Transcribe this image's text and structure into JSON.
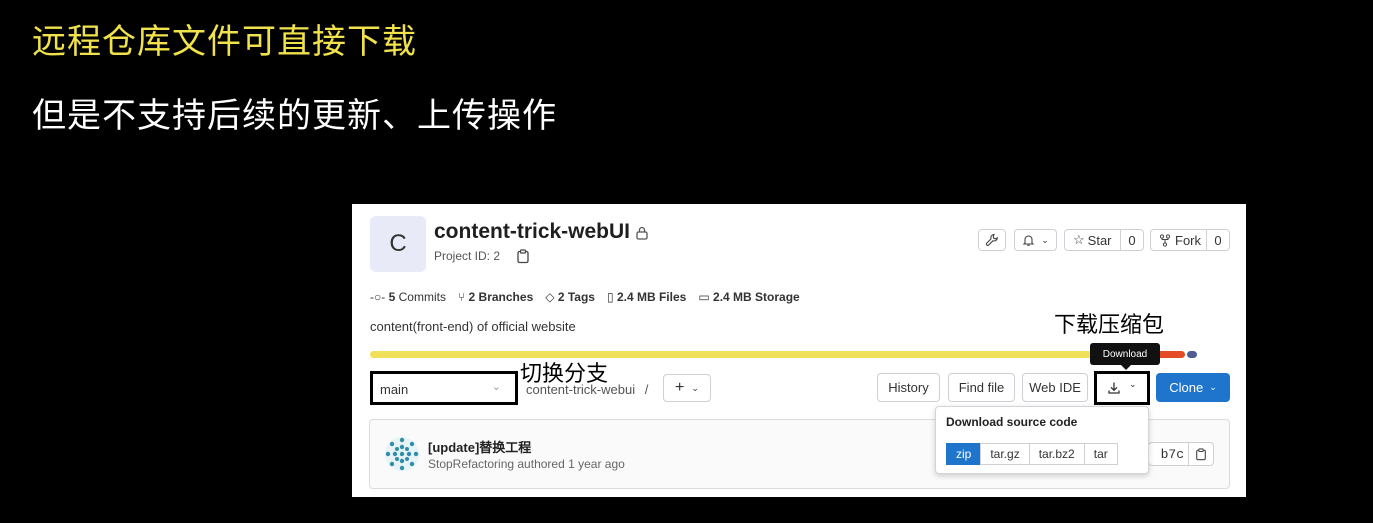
{
  "slide": {
    "title": "远程仓库文件可直接下载",
    "subtitle": "但是不支持后续的更新、上传操作"
  },
  "annotations": {
    "download_package": "下载压缩包",
    "switch_branch": "切换分支"
  },
  "project": {
    "avatar_letter": "C",
    "name": "content-trick-webUI",
    "project_id": "Project ID: 2",
    "description": "content(front-end) of official website"
  },
  "header_actions": {
    "star_label": "Star",
    "star_count": "0",
    "fork_label": "Fork",
    "fork_count": "0"
  },
  "stats": [
    {
      "icon": "commit-icon",
      "value": "5",
      "label": "Commits"
    },
    {
      "icon": "branch-icon",
      "value": "2",
      "label": "Branches"
    },
    {
      "icon": "tag-icon",
      "value": "2",
      "label": "Tags"
    },
    {
      "icon": "file-icon",
      "value": "2.4 MB",
      "label": "Files"
    },
    {
      "icon": "storage-icon",
      "value": "2.4 MB",
      "label": "Storage"
    }
  ],
  "language_bar": {
    "segments": [
      {
        "color": "#f1e05a",
        "fraction": 0.843
      },
      {
        "color": "#563d7c",
        "fraction": 0.06
      },
      {
        "color": "#e34c26",
        "fraction": 0.04
      },
      {
        "color": "#4f5d95",
        "fraction": 0.012
      }
    ]
  },
  "toolbar": {
    "branch": "main",
    "path": "content-trick-webui",
    "path_sep": "/",
    "history": "History",
    "find_file": "Find file",
    "web_ide": "Web IDE",
    "download_tooltip": "Download",
    "clone": "Clone"
  },
  "download_menu": {
    "title": "Download source code",
    "formats": [
      "zip",
      "tar.gz",
      "tar.bz2",
      "tar"
    ],
    "selected": "zip"
  },
  "last_commit": {
    "title": "[update]替换工程",
    "meta": "StopRefactoring authored 1 year ago",
    "sha_partial": "b7c"
  },
  "colors": {
    "slide_title": "#f0e24a",
    "primary": "#1f75cb"
  }
}
